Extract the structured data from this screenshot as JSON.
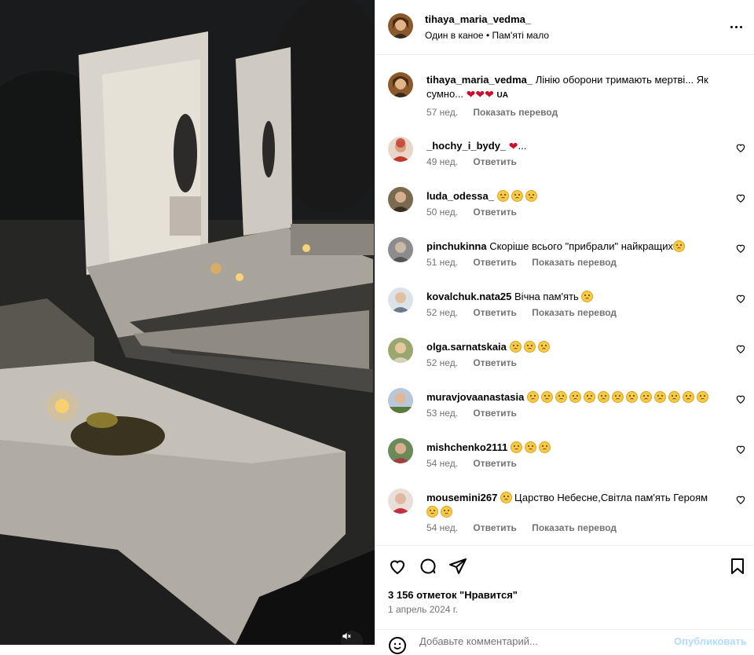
{
  "post": {
    "username": "tihaya_maria_vedma_",
    "audio": "Один в каное • Пам'яті мало",
    "caption_text": "Лінію оборони тримають мертві... Як сумно...",
    "caption_flag": "UA",
    "caption_time": "57 нед.",
    "caption_translate": "Показать перевод"
  },
  "comments": [
    {
      "user": "_hochy_i_bydy_",
      "text": "...",
      "time": "49 нед.",
      "reply": "Ответить",
      "translate": ""
    },
    {
      "user": "luda_odessa_",
      "text": "",
      "time": "50 нед.",
      "reply": "Ответить",
      "translate": ""
    },
    {
      "user": "pinchukinna",
      "text": "Скоріше всього \"прибрали\" найкращих",
      "time": "51 нед.",
      "reply": "Ответить",
      "translate": "Показать перевод"
    },
    {
      "user": "kovalchuk.nata25",
      "text": "Вічна пам'ять",
      "time": "52 нед.",
      "reply": "Ответить",
      "translate": "Показать перевод"
    },
    {
      "user": "olga.sarnatskaia",
      "text": "",
      "time": "52 нед.",
      "reply": "Ответить",
      "translate": ""
    },
    {
      "user": "muravjovaanastasia",
      "text": "",
      "time": "53 нед.",
      "reply": "Ответить",
      "translate": ""
    },
    {
      "user": "mishchenko2111",
      "text": "",
      "time": "54 нед.",
      "reply": "Ответить",
      "translate": ""
    },
    {
      "user": "mousemini267",
      "text": "Царство Небесне,Світла пам'ять Героям",
      "time": "54 нед.",
      "reply": "Ответить",
      "translate": "Показать перевод"
    }
  ],
  "footer": {
    "likes": "3 156 отметок \"Нравится\"",
    "date": "1 апрель 2024 г.",
    "add_comment_placeholder": "Добавьте комментарий...",
    "publish": "Опубликовать"
  },
  "icons": {
    "like": "heart-icon",
    "comment": "comment-icon",
    "share": "share-icon",
    "save": "bookmark-icon",
    "more": "more-horizontal-icon",
    "mute": "volume-muted-icon",
    "emoji": "emoji-icon"
  },
  "colors": {
    "muted_text": "#737373",
    "divider": "#efefef",
    "heart": "#c8102e",
    "publish_disabled": "#b3dbff"
  }
}
